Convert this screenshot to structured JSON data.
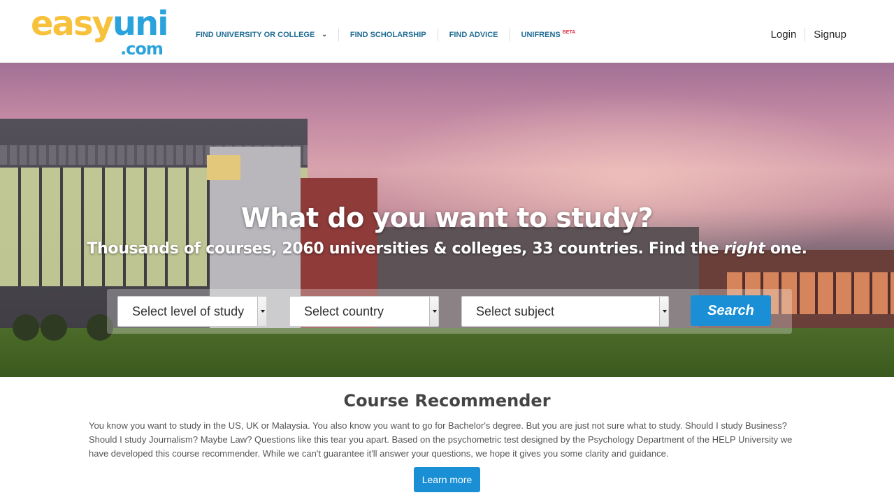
{
  "logo": {
    "part1": "easy",
    "part2": "uni",
    "part3": ".com"
  },
  "nav": {
    "items": [
      {
        "label": "FIND UNIVERSITY OR COLLEGE"
      },
      {
        "label": "FIND SCHOLARSHIP"
      },
      {
        "label": "FIND ADVICE"
      },
      {
        "label": "UNIFRENS",
        "badge": "BETA"
      }
    ],
    "dropdown_icon": "chevron-down-icon"
  },
  "auth": {
    "login": "Login",
    "signup": "Signup"
  },
  "hero": {
    "title": "What do you want to study?",
    "subtitle_before": "Thousands of courses, 2060 universities & colleges, 33 countries. Find the",
    "subtitle_em": "right",
    "subtitle_after": "one."
  },
  "search": {
    "level_placeholder": "Select level of study",
    "country_placeholder": "Select country",
    "subject_placeholder": "Select subject",
    "button_label": "Search"
  },
  "recommender": {
    "title": "Course Recommender",
    "body": "You know you want to study in the US, UK or Malaysia. You also know you want to go for Bachelor's degree. But you are just not sure what to study. Should I study Business? Should I study Journalism? Maybe Law? Questions like this tear you apart. Based on the psychometric test designed by the Psychology Department of the HELP University we have developed this course recommender. While we can't guarantee it'll answer your questions, we hope it gives you some clarity and guidance.",
    "button_label": "Learn more"
  },
  "colors": {
    "accent": "#1a8fd5",
    "nav_text": "#1f6c93",
    "logo_yellow": "#f8c13b",
    "logo_blue": "#2aa3dc",
    "beta_red": "#e0334a"
  }
}
